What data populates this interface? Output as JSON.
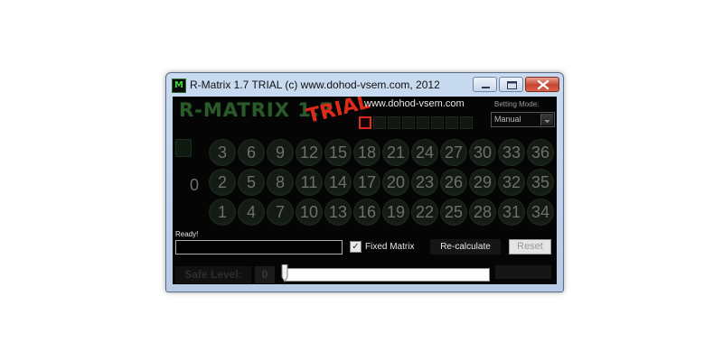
{
  "window": {
    "title": "R-Matrix 1.7 TRIAL (c) www.dohod-vsem.com, 2012",
    "app_icon_glyph": "M"
  },
  "header": {
    "logo": "R-MATRIX 1.7",
    "trial_overlay": "TRIAL",
    "website": "www.dohod-vsem.com",
    "betting_mode_label": "Betting  Mode:",
    "betting_mode_value": "Manual"
  },
  "grid": {
    "zero": "0",
    "rows": [
      [
        "3",
        "6",
        "9",
        "12",
        "15",
        "18",
        "21",
        "24",
        "27",
        "30",
        "33",
        "36"
      ],
      [
        "2",
        "5",
        "8",
        "11",
        "14",
        "17",
        "20",
        "23",
        "26",
        "29",
        "32",
        "35"
      ],
      [
        "1",
        "4",
        "7",
        "10",
        "13",
        "16",
        "19",
        "22",
        "25",
        "28",
        "31",
        "34"
      ]
    ]
  },
  "controls": {
    "status": "Ready!",
    "input_value": "",
    "fixed_matrix_label": "Fixed Matrix",
    "fixed_matrix_checked": true,
    "recalculate_label": "Re-calculate",
    "reset_label": "Reset",
    "safe_level_label": "Safe Level:",
    "safe_level_value": "0"
  },
  "colors": {
    "background": "#050505",
    "accent_red": "#e02a1c",
    "logo_green": "#2c592c"
  },
  "icons": [
    "minimize-icon",
    "maximize-icon",
    "close-icon",
    "dropdown-arrow-icon",
    "checkmark-icon",
    "slider-thumb-icon"
  ]
}
